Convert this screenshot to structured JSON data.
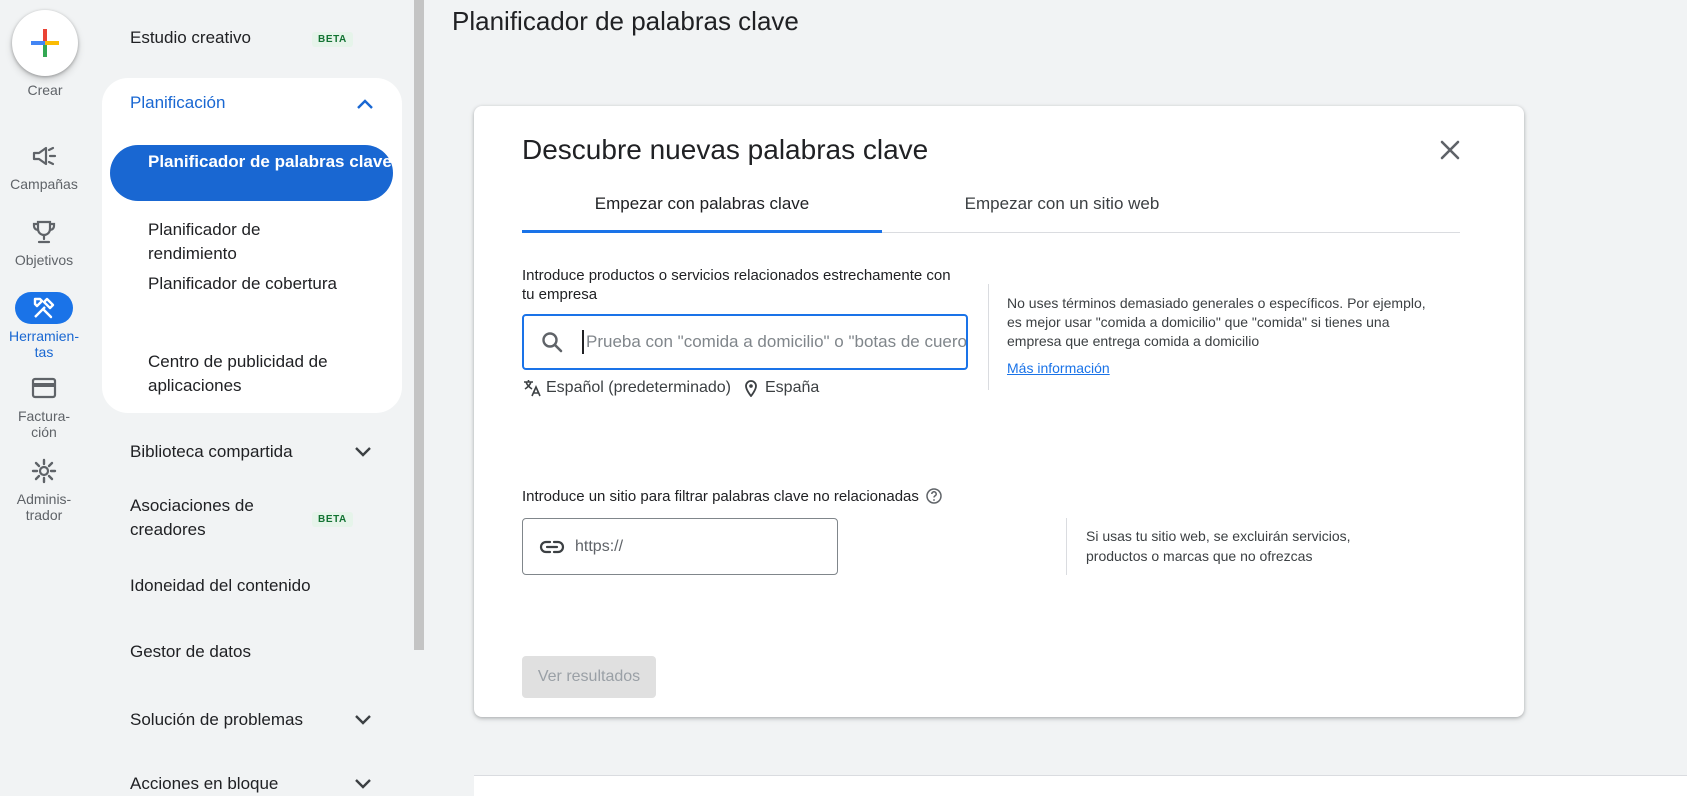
{
  "rail": {
    "create_label": "Crear",
    "items": [
      {
        "label": "Campañas",
        "icon": "megaphone-icon"
      },
      {
        "label": "Objetivos",
        "icon": "trophy-icon"
      },
      {
        "label": "Herramien-\ntas",
        "icon": "tools-icon",
        "active": true
      },
      {
        "label": "Factura-\nción",
        "icon": "credit-card-icon"
      },
      {
        "label": "Adminis-\ntrador",
        "icon": "gear-icon"
      }
    ]
  },
  "nav": {
    "studio": "Estudio creativo",
    "beta": "BETA",
    "planning": {
      "title": "Planificación",
      "items": [
        "Planificador de palabras clave",
        "Planificador de rendimiento",
        "Planificador de cobertura",
        "Centro de publicidad de aplicaciones"
      ]
    },
    "shared_library": "Biblioteca compartida",
    "creator_partnerships": "Asociaciones de creadores",
    "content_suitability": "Idoneidad del contenido",
    "data_manager": "Gestor de datos",
    "troubleshooting": "Solución de problemas",
    "bulk_actions": "Acciones en bloque"
  },
  "page": {
    "title": "Planificador de palabras clave"
  },
  "card": {
    "title": "Descubre nuevas palabras clave",
    "tabs": [
      "Empezar con palabras clave",
      "Empezar con un sitio web"
    ],
    "keyword_label": "Introduce productos o servicios relacionados estrechamente con tu empresa",
    "search_placeholder": "Prueba con \"comida a domicilio\" o \"botas de cuero\"",
    "language": "Español (predeterminado)",
    "location": "España",
    "tip": "No uses términos demasiado generales o específicos. Por ejemplo, es mejor usar \"comida a domicilio\" que \"comida\" si tienes una empresa que entrega comida a domicilio",
    "more_info": "Más información",
    "site_label": "Introduce un sitio para filtrar palabras clave no relacionadas",
    "url_placeholder": "https://",
    "site_tip": "Si usas tu sitio web, se excluirán servicios, productos o marcas que no ofrezcas",
    "results_button": "Ver resultados"
  },
  "colors": {
    "accent": "#1a73e8",
    "active_nav": "#1967d2",
    "beta_text": "#137333",
    "background": "#f1f3f4"
  }
}
